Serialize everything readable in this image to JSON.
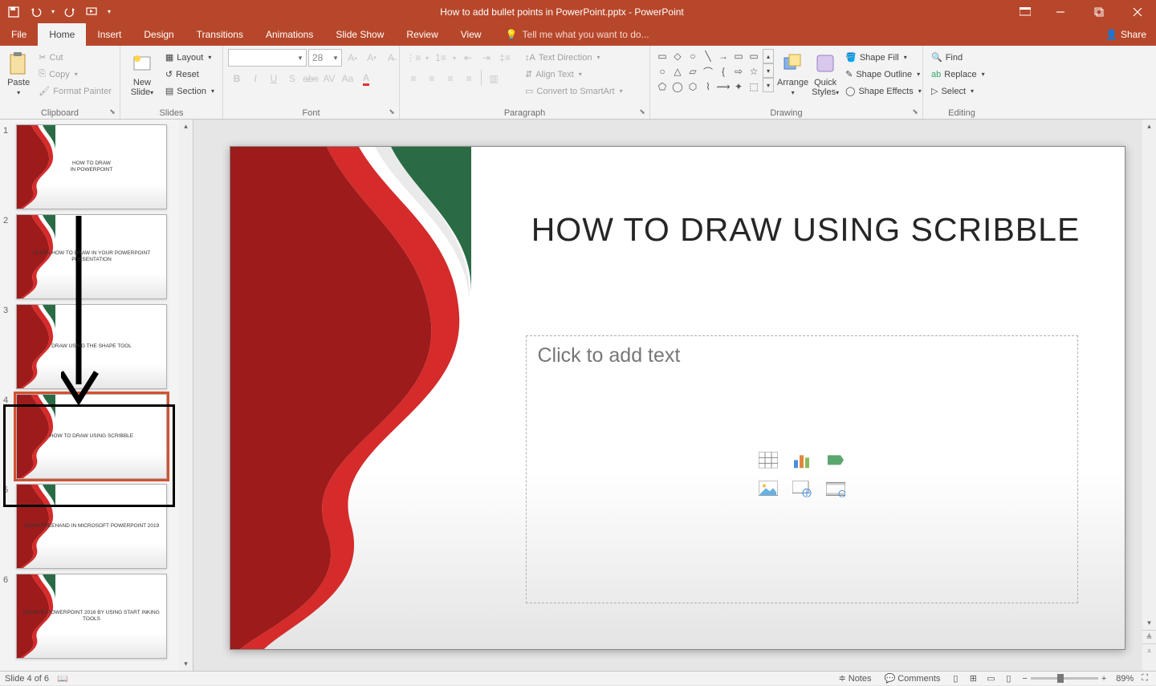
{
  "title": "How to add bullet points in PowerPoint.pptx - PowerPoint",
  "qat": [
    "save",
    "undo",
    "redo",
    "start-from-beginning"
  ],
  "tabs": [
    "File",
    "Home",
    "Insert",
    "Design",
    "Transitions",
    "Animations",
    "Slide Show",
    "Review",
    "View"
  ],
  "active_tab": "Home",
  "tell_me": "Tell me what you want to do...",
  "share": "Share",
  "ribbon": {
    "clipboard": {
      "label": "Clipboard",
      "paste": "Paste",
      "cut": "Cut",
      "copy": "Copy",
      "format_painter": "Format Painter"
    },
    "slides": {
      "label": "Slides",
      "new_slide": "New\nSlide",
      "layout": "Layout",
      "reset": "Reset",
      "section": "Section"
    },
    "font": {
      "label": "Font",
      "name": "",
      "size": "28"
    },
    "paragraph": {
      "label": "Paragraph",
      "text_direction": "Text Direction",
      "align_text": "Align Text",
      "convert_smartart": "Convert to SmartArt"
    },
    "drawing": {
      "label": "Drawing",
      "arrange": "Arrange",
      "quick_styles": "Quick\nStyles",
      "shape_fill": "Shape Fill",
      "shape_outline": "Shape Outline",
      "shape_effects": "Shape Effects"
    },
    "editing": {
      "label": "Editing",
      "find": "Find",
      "replace": "Replace",
      "select": "Select"
    }
  },
  "thumbnails": [
    {
      "num": "1",
      "title": "HOW TO DRAW\nIN POWERPOINT"
    },
    {
      "num": "2",
      "title": "LEARN HOW TO DRAW IN YOUR POWERPOINT PRESENTATION"
    },
    {
      "num": "3",
      "title": "DRAW USING THE SHAPE TOOL"
    },
    {
      "num": "4",
      "title": "HOW TO DRAW USING SCRIBBLE",
      "selected": true
    },
    {
      "num": "5",
      "title": "DRAW FREEHAND IN MICROSOFT POWERPOINT 2019"
    },
    {
      "num": "6",
      "title": "DRAW IN POWERPOINT 2016 BY USING START INKING TOOLS"
    }
  ],
  "slide": {
    "title": "HOW TO DRAW USING SCRIBBLE",
    "placeholder": "Click to add text"
  },
  "status": {
    "slide_info": "Slide 4 of 6",
    "notes": "Notes",
    "comments": "Comments",
    "zoom": "89%"
  }
}
